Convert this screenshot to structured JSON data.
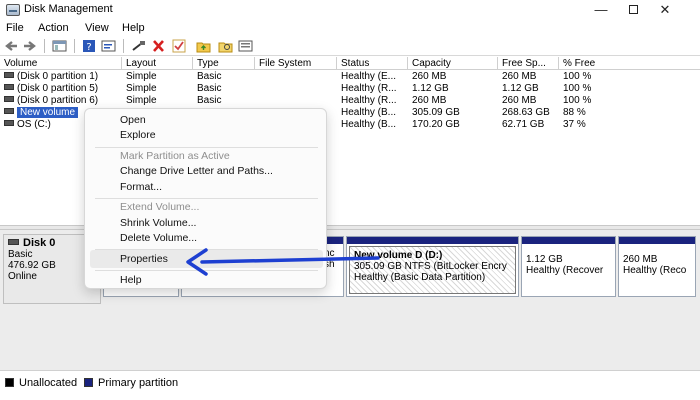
{
  "window": {
    "title": "Disk Management",
    "controls": {
      "minimize": "—",
      "close": "✕"
    }
  },
  "menu": [
    "File",
    "Action",
    "View",
    "Help"
  ],
  "toolbar": [
    "back-icon",
    "forward-icon",
    "show-hide-console-tree-icon",
    "help-icon",
    "properties-icon",
    "connect-drive-icon",
    "delete-icon",
    "checkmark-icon",
    "folder-up-icon",
    "search-folder-icon",
    "view-icon"
  ],
  "volume_table": {
    "columns": [
      "Volume",
      "Layout",
      "Type",
      "File System",
      "Status",
      "Capacity",
      "Free Sp...",
      "% Free"
    ],
    "rows": [
      {
        "volume": "(Disk 0 partition 1)",
        "layout": "Simple",
        "type": "Basic",
        "fs": "",
        "status": "Healthy (E...",
        "capacity": "260 MB",
        "free": "260 MB",
        "pct": "100 %"
      },
      {
        "volume": "(Disk 0 partition 5)",
        "layout": "Simple",
        "type": "Basic",
        "fs": "",
        "status": "Healthy (R...",
        "capacity": "1.12 GB",
        "free": "1.12 GB",
        "pct": "100 %"
      },
      {
        "volume": "(Disk 0 partition 6)",
        "layout": "Simple",
        "type": "Basic",
        "fs": "",
        "status": "Healthy (R...",
        "capacity": "260 MB",
        "free": "260 MB",
        "pct": "100 %"
      },
      {
        "volume": "New volume",
        "layout": "",
        "type": "",
        "fs": "",
        "status": "Healthy (B...",
        "capacity": "305.09 GB",
        "free": "268.63 GB",
        "pct": "88 %"
      },
      {
        "volume": "OS (C:)",
        "layout": "",
        "type": "",
        "fs": "",
        "status": "Healthy (B...",
        "capacity": "170.20 GB",
        "free": "62.71 GB",
        "pct": "37 %"
      }
    ]
  },
  "disk": {
    "name": "Disk 0",
    "type": "Basic",
    "size": "476.92 GB",
    "status": "Online",
    "partitions": [
      {
        "line1": "",
        "line2": ""
      },
      {
        "line1": "nc",
        "line2": "sh"
      },
      {
        "title": "New volume D  (D:)",
        "line1": "305.09 GB NTFS (BitLocker Encry",
        "line2": "Healthy (Basic Data Partition)"
      },
      {
        "line1": "1.12 GB",
        "line2": "Healthy (Recover"
      },
      {
        "line1": "260 MB",
        "line2": "Healthy (Reco"
      }
    ]
  },
  "context_menu": {
    "items": [
      "Open",
      "Explore",
      "Mark Partition as Active",
      "Change Drive Letter and Paths...",
      "Format...",
      "Extend Volume...",
      "Shrink Volume...",
      "Delete Volume...",
      "Properties",
      "Help"
    ],
    "disabled": [
      "Mark Partition as Active",
      "Extend Volume..."
    ],
    "highlighted": "Properties"
  },
  "legend": [
    {
      "label": "Unallocated",
      "color": "#000000"
    },
    {
      "label": "Primary partition",
      "color": "#1a237e"
    }
  ],
  "colors": {
    "selection": "#2d5ec5",
    "primary_partition": "#1a237e",
    "arrow": "#1d3fd1"
  }
}
